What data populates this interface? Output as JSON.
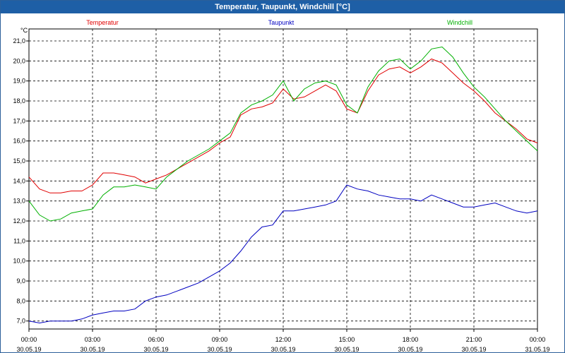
{
  "window": {
    "title": "Temperatur, Taupunkt, Windchill [°C]"
  },
  "chart_data": {
    "type": "line",
    "title": "Temperatur, Taupunkt, Windchill [°C]",
    "ylabel": "°C",
    "ylim": [
      6.6,
      21.6
    ],
    "xlim": [
      "30.05.19 00:00",
      "31.05.19 00:00"
    ],
    "grid": true,
    "legend_position": "top",
    "y_ticks": [
      "7,0",
      "8,0",
      "9,0",
      "10,0",
      "11,0",
      "12,0",
      "13,0",
      "14,0",
      "15,0",
      "16,0",
      "17,0",
      "18,0",
      "19,0",
      "20,0",
      "21,0"
    ],
    "y_tick_values": [
      7,
      8,
      9,
      10,
      11,
      12,
      13,
      14,
      15,
      16,
      17,
      18,
      19,
      20,
      21
    ],
    "x_ticks": [
      {
        "time": "00:00",
        "date": "30.05.19"
      },
      {
        "time": "03:00",
        "date": "30.05.19"
      },
      {
        "time": "06:00",
        "date": "30.05.19"
      },
      {
        "time": "09:00",
        "date": "30.05.19"
      },
      {
        "time": "12:00",
        "date": "30.05.19"
      },
      {
        "time": "15:00",
        "date": "30.05.19"
      },
      {
        "time": "18:00",
        "date": "30.05.19"
      },
      {
        "time": "21:00",
        "date": "30.05.19"
      },
      {
        "time": "00:00",
        "date": "31.05.19"
      }
    ],
    "x_tick_hours": [
      0,
      3,
      6,
      9,
      12,
      15,
      18,
      21,
      24
    ],
    "series": [
      {
        "name": "Temperatur",
        "color": "#e00000",
        "x": [
          0,
          0.5,
          1,
          1.5,
          2,
          2.5,
          3,
          3.5,
          4,
          4.5,
          5,
          5.5,
          6,
          6.5,
          7,
          7.5,
          8,
          8.5,
          9,
          9.5,
          10,
          10.5,
          11,
          11.5,
          12,
          12.5,
          13,
          13.5,
          14,
          14.5,
          15,
          15.5,
          16,
          16.5,
          17,
          17.5,
          18,
          18.5,
          19,
          19.5,
          20,
          20.5,
          21,
          21.5,
          22,
          22.5,
          23,
          23.5,
          24
        ],
        "values": [
          14.2,
          13.6,
          13.4,
          13.4,
          13.5,
          13.5,
          13.8,
          14.4,
          14.4,
          14.3,
          14.2,
          13.9,
          14.1,
          14.3,
          14.6,
          14.9,
          15.2,
          15.5,
          15.9,
          16.2,
          17.3,
          17.6,
          17.7,
          17.9,
          18.6,
          18.1,
          18.2,
          18.5,
          18.8,
          18.5,
          17.6,
          17.4,
          18.5,
          19.3,
          19.6,
          19.7,
          19.4,
          19.7,
          20.1,
          19.9,
          19.4,
          18.9,
          18.5,
          18.0,
          17.4,
          17.0,
          16.6,
          16.1,
          15.9
        ]
      },
      {
        "name": "Taupunkt",
        "color": "#0000c0",
        "x": [
          0,
          0.5,
          1,
          1.5,
          2,
          2.5,
          3,
          3.5,
          4,
          4.5,
          5,
          5.5,
          6,
          6.5,
          7,
          7.5,
          8,
          8.5,
          9,
          9.5,
          10,
          10.5,
          11,
          11.5,
          12,
          12.5,
          13,
          13.5,
          14,
          14.5,
          15,
          15.5,
          16,
          16.5,
          17,
          17.5,
          18,
          18.5,
          19,
          19.5,
          20,
          20.5,
          21,
          21.5,
          22,
          22.5,
          23,
          23.5,
          24
        ],
        "values": [
          7.0,
          6.9,
          7.0,
          7.0,
          7.0,
          7.1,
          7.3,
          7.4,
          7.5,
          7.5,
          7.6,
          8.0,
          8.2,
          8.3,
          8.5,
          8.7,
          8.9,
          9.2,
          9.5,
          9.9,
          10.5,
          11.2,
          11.7,
          11.8,
          12.5,
          12.5,
          12.6,
          12.7,
          12.8,
          13.0,
          13.8,
          13.6,
          13.5,
          13.3,
          13.2,
          13.1,
          13.1,
          13.0,
          13.3,
          13.1,
          12.9,
          12.7,
          12.7,
          12.8,
          12.9,
          12.7,
          12.5,
          12.4,
          12.5
        ]
      },
      {
        "name": "Windchill",
        "color": "#00b000",
        "x": [
          0,
          0.5,
          1,
          1.5,
          2,
          2.5,
          3,
          3.5,
          4,
          4.5,
          5,
          5.5,
          6,
          6.5,
          7,
          7.5,
          8,
          8.5,
          9,
          9.5,
          10,
          10.5,
          11,
          11.5,
          12,
          12.5,
          13,
          13.5,
          14,
          14.5,
          15,
          15.5,
          16,
          16.5,
          17,
          17.5,
          18,
          18.5,
          19,
          19.5,
          20,
          20.5,
          21,
          21.5,
          22,
          22.5,
          23,
          23.5,
          24
        ],
        "values": [
          13.0,
          12.3,
          12.0,
          12.1,
          12.4,
          12.5,
          12.6,
          13.3,
          13.7,
          13.7,
          13.8,
          13.7,
          13.6,
          14.2,
          14.6,
          15.0,
          15.3,
          15.6,
          16.0,
          16.4,
          17.4,
          17.8,
          18.0,
          18.3,
          19.0,
          18.0,
          18.6,
          18.9,
          19.0,
          18.8,
          17.8,
          17.4,
          18.7,
          19.5,
          20.0,
          20.1,
          19.6,
          20.0,
          20.6,
          20.7,
          20.2,
          19.4,
          18.7,
          18.2,
          17.6,
          17.0,
          16.5,
          16.0,
          15.5
        ]
      }
    ]
  }
}
